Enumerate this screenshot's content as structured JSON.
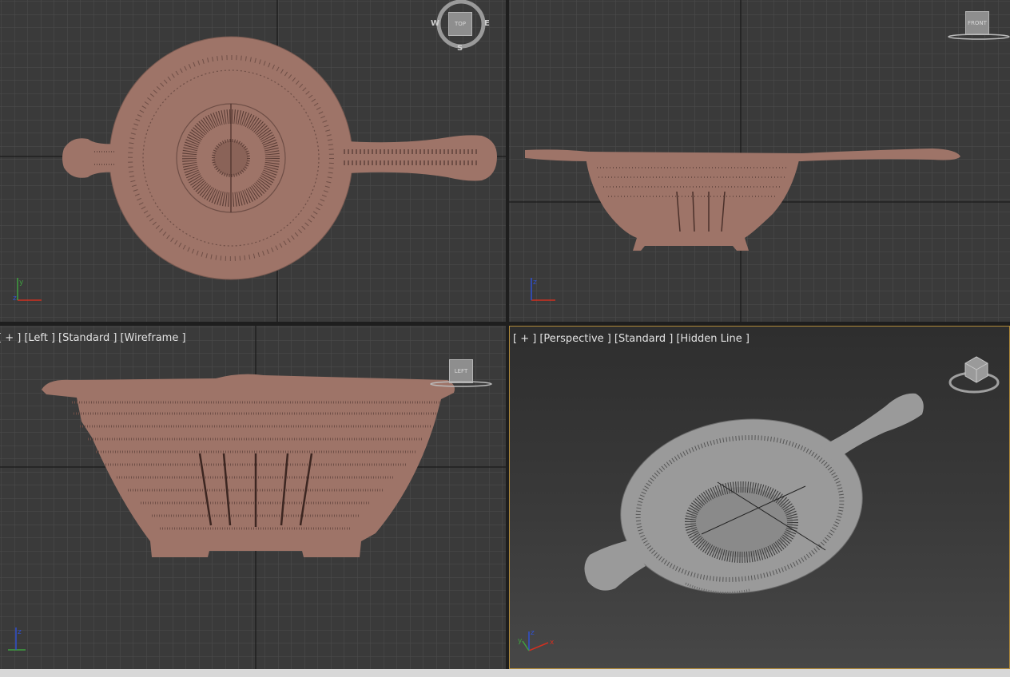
{
  "viewports": {
    "top": {
      "viewcube_face": "TOP",
      "compass": {
        "west": "W",
        "east": "E",
        "south": "S"
      }
    },
    "front": {
      "viewcube_face": "FRONT"
    },
    "left": {
      "labels": [
        "[ + ]",
        "[Left ]",
        "[Standard ]",
        "[Wireframe ]"
      ],
      "viewcube_face": "LEFT"
    },
    "perspective": {
      "labels": [
        "[ + ]",
        "[Perspective ]",
        "[Standard ]",
        "[Hidden Line ]"
      ]
    }
  },
  "axis_labels": {
    "y": "y",
    "z": "z",
    "x": "x"
  },
  "colors": {
    "grid_bg": "#3a3a3a",
    "grid_minor": "#4c4c4c",
    "grid_major": "#0a0a0a",
    "model_fill": "#9e7468",
    "model_wire": "#6e4e46",
    "persp_model": "#9a9a9a",
    "active_border": "#b08a3a"
  }
}
